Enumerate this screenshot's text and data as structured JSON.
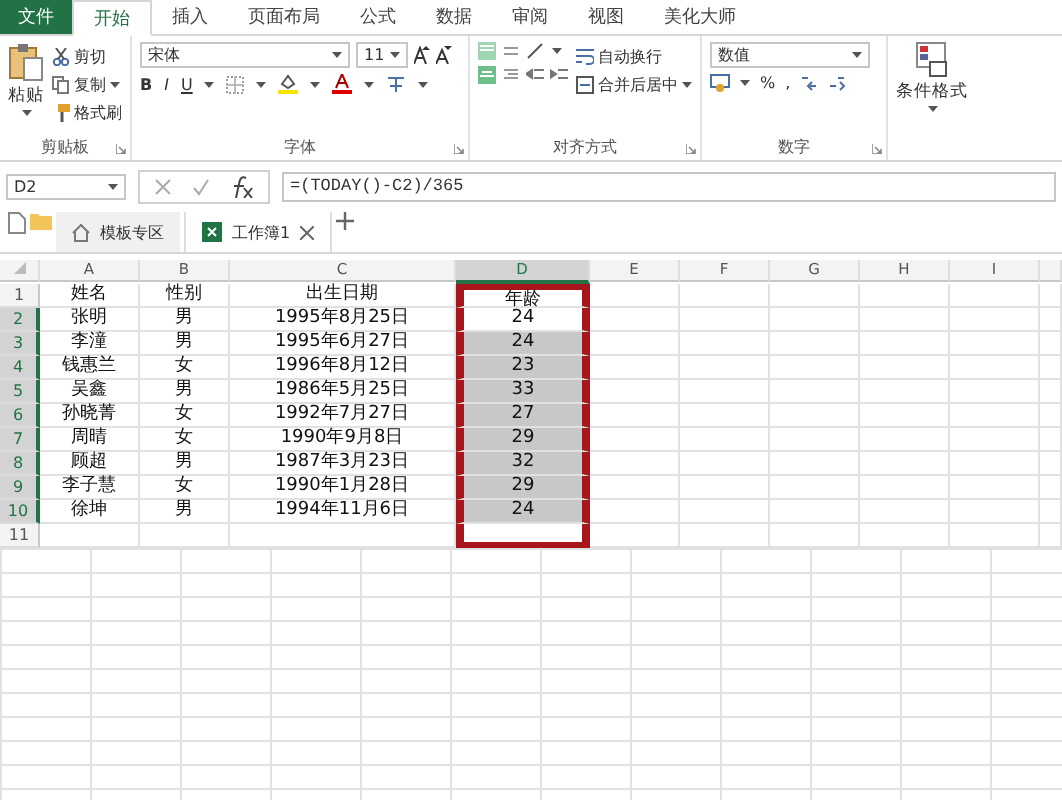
{
  "ribbon_tabs": [
    {
      "label": "文件",
      "kind": "file",
      "selected": false
    },
    {
      "label": "开始",
      "kind": "tab",
      "selected": true
    },
    {
      "label": "插入",
      "kind": "tab",
      "selected": false
    },
    {
      "label": "页面布局",
      "kind": "tab",
      "selected": false
    },
    {
      "label": "公式",
      "kind": "tab",
      "selected": false
    },
    {
      "label": "数据",
      "kind": "tab",
      "selected": false
    },
    {
      "label": "审阅",
      "kind": "tab",
      "selected": false
    },
    {
      "label": "视图",
      "kind": "tab",
      "selected": false
    },
    {
      "label": "美化大师",
      "kind": "tab",
      "selected": false
    }
  ],
  "clipboard": {
    "paste": "粘贴",
    "cut": "剪切",
    "copy": "复制",
    "format_painter": "格式刷",
    "group_label": "剪贴板"
  },
  "font": {
    "family": "宋体",
    "size": "11",
    "bold": "B",
    "italic": "I",
    "underline": "U",
    "group_label": "字体"
  },
  "alignment": {
    "wrap": "自动换行",
    "merge": "合并后居中",
    "group_label": "对齐方式"
  },
  "number": {
    "format": "数值",
    "percent": "%",
    "comma": ",",
    "group_label": "数字"
  },
  "styles": {
    "conditional_format": "条件格式"
  },
  "formula_bar": {
    "name_box": "D2",
    "formula": "=(TODAY()-C2)/365"
  },
  "doc_tabs": [
    {
      "label": "模板专区",
      "kind": "home",
      "selected": false
    },
    {
      "label": "工作簿1",
      "kind": "workbook",
      "selected": true
    }
  ],
  "sheet": {
    "columns": [
      {
        "label": "A",
        "selected": false,
        "highlighted": false
      },
      {
        "label": "B",
        "selected": false,
        "highlighted": false
      },
      {
        "label": "C",
        "selected": false,
        "highlighted": false
      },
      {
        "label": "D",
        "selected": true,
        "highlighted": true
      },
      {
        "label": "E",
        "selected": false,
        "highlighted": false
      },
      {
        "label": "F",
        "selected": false,
        "highlighted": false
      },
      {
        "label": "G",
        "selected": false,
        "highlighted": false
      },
      {
        "label": "H",
        "selected": false,
        "highlighted": false
      },
      {
        "label": "I",
        "selected": false,
        "highlighted": false
      }
    ],
    "rows": [
      {
        "number": "1",
        "selected": false,
        "cells": [
          "姓名",
          "性别",
          "出生日期",
          "年龄"
        ]
      },
      {
        "number": "2",
        "selected": true,
        "cells": [
          "张明",
          "男",
          "1995年8月25日",
          "24"
        ]
      },
      {
        "number": "3",
        "selected": true,
        "cells": [
          "李潼",
          "男",
          "1995年6月27日",
          "24"
        ]
      },
      {
        "number": "4",
        "selected": true,
        "cells": [
          "钱惠兰",
          "女",
          "1996年8月12日",
          "23"
        ]
      },
      {
        "number": "5",
        "selected": true,
        "cells": [
          "吴鑫",
          "男",
          "1986年5月25日",
          "33"
        ]
      },
      {
        "number": "6",
        "selected": true,
        "cells": [
          "孙晓菁",
          "女",
          "1992年7月27日",
          "27"
        ]
      },
      {
        "number": "7",
        "selected": true,
        "cells": [
          "周晴",
          "女",
          "1990年9月8日",
          "29"
        ]
      },
      {
        "number": "8",
        "selected": true,
        "cells": [
          "顾超",
          "男",
          "1987年3月23日",
          "32"
        ]
      },
      {
        "number": "9",
        "selected": true,
        "cells": [
          "李子慧",
          "女",
          "1990年1月28日",
          "29"
        ]
      },
      {
        "number": "10",
        "selected": true,
        "cells": [
          "徐坤",
          "男",
          "1994年11月6日",
          "24"
        ]
      },
      {
        "number": "11",
        "selected": false,
        "cells": []
      }
    ]
  }
}
